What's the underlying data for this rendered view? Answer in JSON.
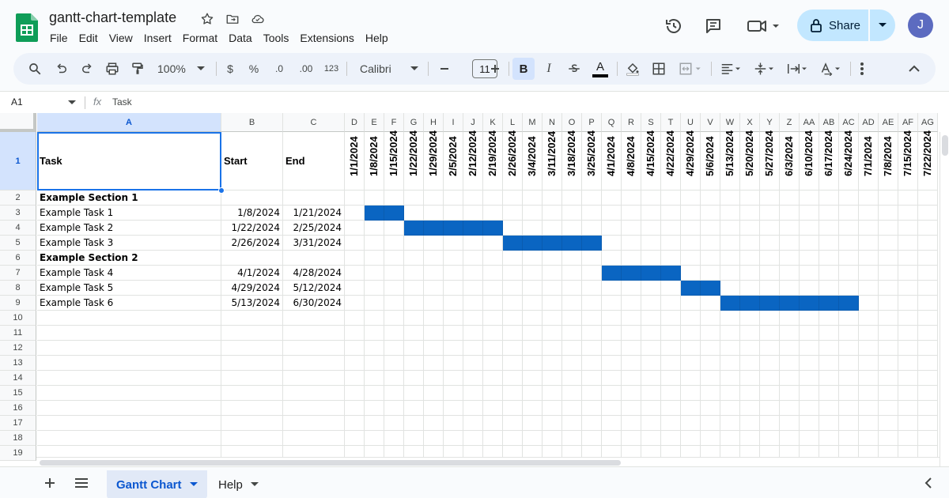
{
  "document": {
    "title": "gantt-chart-template"
  },
  "menu": [
    "File",
    "Edit",
    "View",
    "Insert",
    "Format",
    "Data",
    "Tools",
    "Extensions",
    "Help"
  ],
  "share": {
    "label": "Share"
  },
  "user": {
    "initial": "J"
  },
  "toolbar": {
    "zoom": "100%",
    "currency": "$",
    "percent": "%",
    "decrease_decimal": ".0",
    "increase_decimal": ".00",
    "number_format": "123",
    "font": "Calibri",
    "font_size": "11",
    "bold": "B",
    "italic": "I",
    "text_color_letter": "A",
    "text_color": "#000000",
    "icons": [
      "search-icon",
      "undo-icon",
      "redo-icon",
      "print-icon",
      "paint-format-icon",
      "minus-icon",
      "plus-icon",
      "strikethrough-icon",
      "fill-color-icon",
      "borders-icon",
      "merge-cells-icon",
      "align-left-icon",
      "vertical-align-icon",
      "text-wrap-icon",
      "text-rotation-icon",
      "more-vert-icon",
      "collapse-icon"
    ]
  },
  "formula_bar": {
    "cell_ref": "A1",
    "fx": "fx",
    "value": "Task"
  },
  "grid": {
    "selected_cell": "A1",
    "columns": [
      "A",
      "B",
      "C",
      "D",
      "E",
      "F",
      "G",
      "H",
      "I",
      "J",
      "K",
      "L",
      "M",
      "N",
      "O",
      "P",
      "Q",
      "R",
      "S",
      "T",
      "U",
      "V",
      "W",
      "X",
      "Y",
      "Z",
      "AA",
      "AB",
      "AC",
      "AD",
      "AE",
      "AF",
      "AG"
    ],
    "rows": [
      "1",
      "2",
      "3",
      "4",
      "5",
      "6",
      "7",
      "8",
      "9",
      "10",
      "11",
      "12",
      "13",
      "14",
      "15",
      "16",
      "17",
      "18",
      "19"
    ],
    "header": {
      "task": "Task",
      "start": "Start",
      "end": "End"
    },
    "weeks": [
      "1/1/2024",
      "1/8/2024",
      "1/15/2024",
      "1/22/2024",
      "1/29/2024",
      "2/5/2024",
      "2/12/2024",
      "2/19/2024",
      "2/26/2024",
      "3/4/2024",
      "3/11/2024",
      "3/18/2024",
      "3/25/2024",
      "4/1/2024",
      "4/8/2024",
      "4/15/2024",
      "4/22/2024",
      "4/29/2024",
      "5/6/2024",
      "5/13/2024",
      "5/20/2024",
      "5/27/2024",
      "6/3/2024",
      "6/10/2024",
      "6/17/2024",
      "6/24/2024",
      "7/1/2024",
      "7/8/2024",
      "7/15/2024",
      "7/22/2024"
    ],
    "bar_color": "#0a65c2",
    "data_rows": [
      {
        "task": "Example Section 1",
        "start": "",
        "end": "",
        "section": true,
        "bar": null
      },
      {
        "task": "Example Task 1",
        "start": "1/8/2024",
        "end": "1/21/2024",
        "section": false,
        "bar": {
          "from_week": "1/8/2024",
          "to_week": "1/15/2024"
        }
      },
      {
        "task": "Example Task 2",
        "start": "1/22/2024",
        "end": "2/25/2024",
        "section": false,
        "bar": {
          "from_week": "1/22/2024",
          "to_week": "2/19/2024"
        }
      },
      {
        "task": "Example Task 3",
        "start": "2/26/2024",
        "end": "3/31/2024",
        "section": false,
        "bar": {
          "from_week": "2/26/2024",
          "to_week": "3/25/2024"
        }
      },
      {
        "task": "Example Section 2",
        "start": "",
        "end": "",
        "section": true,
        "bar": null
      },
      {
        "task": "Example Task 4",
        "start": "4/1/2024",
        "end": "4/28/2024",
        "section": false,
        "bar": {
          "from_week": "4/1/2024",
          "to_week": "4/22/2024"
        }
      },
      {
        "task": "Example Task 5",
        "start": "4/29/2024",
        "end": "5/12/2024",
        "section": false,
        "bar": {
          "from_week": "4/29/2024",
          "to_week": "5/6/2024"
        }
      },
      {
        "task": "Example Task 6",
        "start": "5/13/2024",
        "end": "6/30/2024",
        "section": false,
        "bar": {
          "from_week": "5/13/2024",
          "to_week": "6/24/2024"
        }
      }
    ]
  },
  "sheets": [
    {
      "name": "Gantt Chart",
      "active": true
    },
    {
      "name": "Help",
      "active": false
    }
  ]
}
